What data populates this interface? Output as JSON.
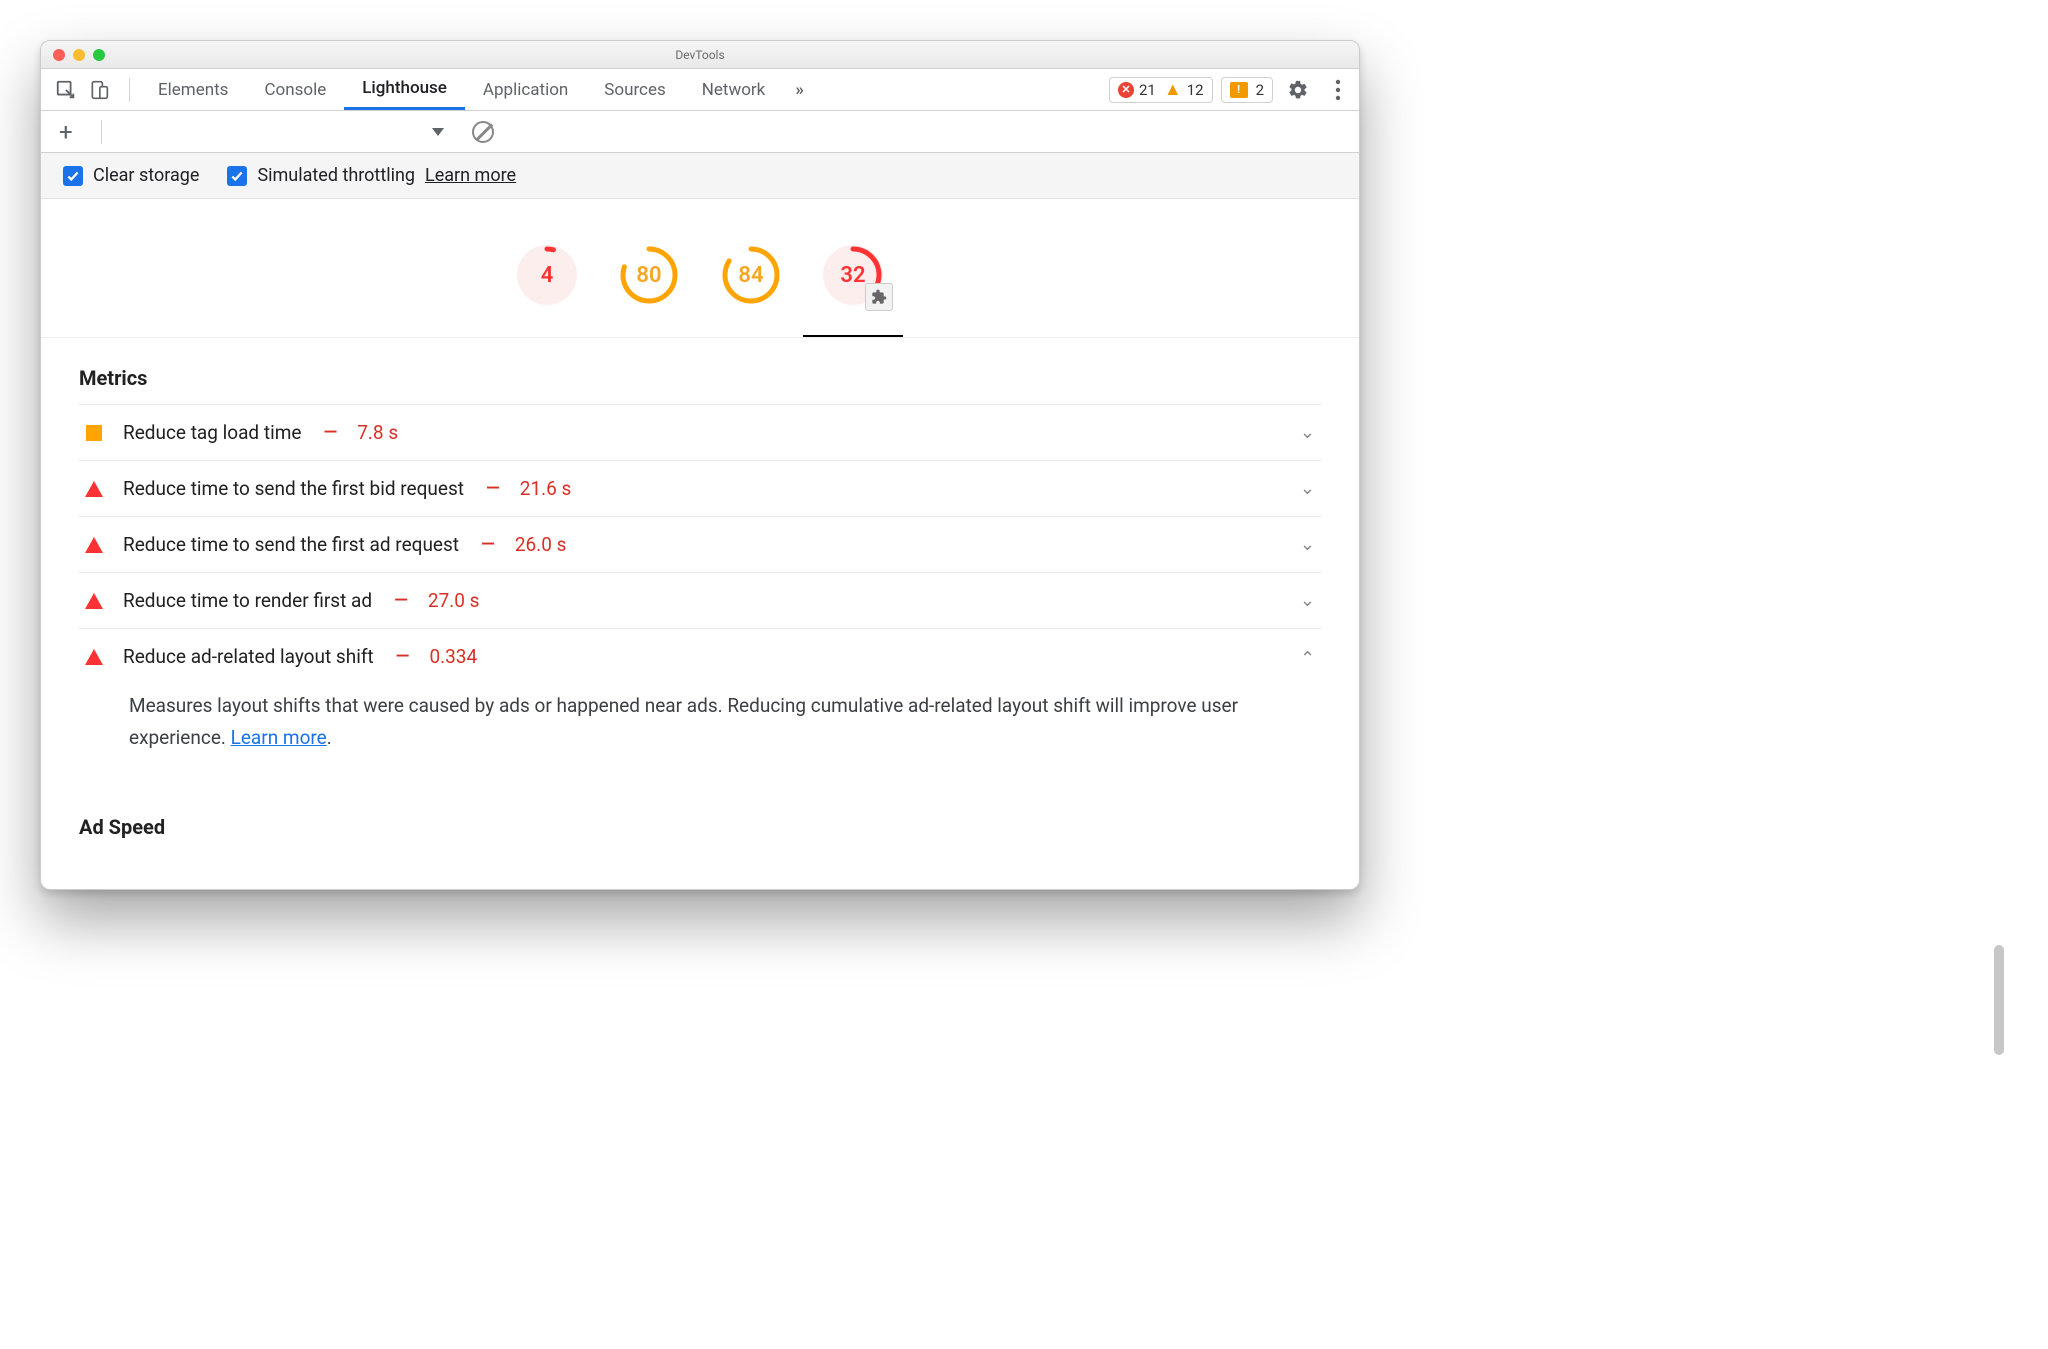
{
  "window": {
    "title": "DevTools"
  },
  "tabs": {
    "items": [
      "Elements",
      "Console",
      "Lighthouse",
      "Application",
      "Sources",
      "Network"
    ],
    "active": "Lighthouse"
  },
  "badges": {
    "errors": "21",
    "warnings": "12",
    "notes": "2"
  },
  "options": {
    "clear_storage": "Clear storage",
    "simulated_throttling": "Simulated throttling",
    "learn_more": "Learn more"
  },
  "gauges": [
    {
      "value": "4",
      "level": "red",
      "pct": 4,
      "has_plugin": false
    },
    {
      "value": "80",
      "level": "orange",
      "pct": 80,
      "has_plugin": false
    },
    {
      "value": "84",
      "level": "orange",
      "pct": 84,
      "has_plugin": false
    },
    {
      "value": "32",
      "level": "red",
      "pct": 32,
      "has_plugin": true,
      "selected": true
    }
  ],
  "sections": {
    "metrics_title": "Metrics",
    "adspeed_title": "Ad Speed"
  },
  "metrics": [
    {
      "icon": "square-orange",
      "label": "Reduce tag load time",
      "value": "7.8 s",
      "expanded": false
    },
    {
      "icon": "triangle-red",
      "label": "Reduce time to send the first bid request",
      "value": "21.6 s",
      "expanded": false
    },
    {
      "icon": "triangle-red",
      "label": "Reduce time to send the first ad request",
      "value": "26.0 s",
      "expanded": false
    },
    {
      "icon": "triangle-red",
      "label": "Reduce time to render first ad",
      "value": "27.0 s",
      "expanded": false
    },
    {
      "icon": "triangle-red",
      "label": "Reduce ad-related layout shift",
      "value": "0.334",
      "expanded": true,
      "description": "Measures layout shifts that were caused by ads or happened near ads. Reducing cumulative ad-related layout shift will improve user experience. ",
      "description_link": "Learn more"
    }
  ]
}
